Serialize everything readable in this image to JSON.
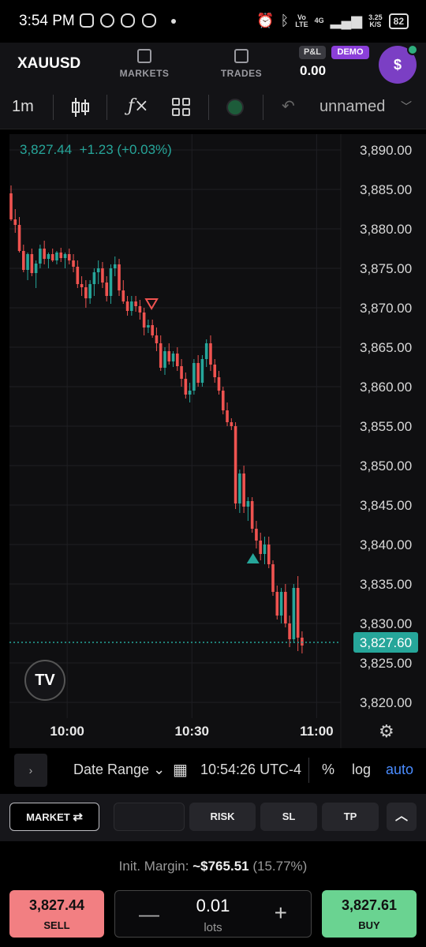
{
  "status_bar": {
    "time": "3:54 PM",
    "net_top": "Vo",
    "net_bottom": "LTE",
    "gen": "4G",
    "speed_top": "3.25",
    "speed_bottom": "K/S",
    "battery": "82"
  },
  "nav": {
    "symbol": "XAUUSD",
    "markets_label": "MARKETS",
    "trades_label": "TRADES",
    "pnl_badge": "P&L",
    "demo_badge": "DEMO",
    "pnl_value": "0.00",
    "account_icon": "$"
  },
  "toolbar": {
    "interval": "1m",
    "layout_name": "unnamed"
  },
  "chart_data": {
    "type": "candlestick",
    "legend_price": "3,827.44",
    "legend_change": "+1.23 (+0.03%)",
    "ylim": [
      3818,
      3892
    ],
    "y_ticks": [
      3890,
      3885,
      3880,
      3875,
      3870,
      3865,
      3860,
      3855,
      3850,
      3845,
      3840,
      3835,
      3830,
      3825,
      3820
    ],
    "y_tick_labels": [
      "3,890.00",
      "3,885.00",
      "3,880.00",
      "3,875.00",
      "3,870.00",
      "3,865.00",
      "3,860.00",
      "3,855.00",
      "3,850.00",
      "3,845.00",
      "3,840.00",
      "3,835.00",
      "3,830.00",
      "3,825.00",
      "3,820.00"
    ],
    "x_ticks": [
      "10:00",
      "10:30",
      "11:00"
    ],
    "x_tick_minutes": [
      13.5,
      43.5,
      73.5
    ],
    "current_price": 3827.6,
    "current_price_label": "3,827.60",
    "colors": {
      "up": "#26a69a",
      "down": "#ef5350",
      "grid": "#1f1f23",
      "bg": "#0f0f11"
    },
    "candles": [
      [
        3884.5,
        3885.5,
        3881.0,
        3881.2
      ],
      [
        3881.2,
        3882.5,
        3879.5,
        3880.5
      ],
      [
        3880.5,
        3881.5,
        3877.0,
        3877.2
      ],
      [
        3877.2,
        3878.0,
        3874.5,
        3874.8
      ],
      [
        3874.8,
        3877.0,
        3873.5,
        3876.8
      ],
      [
        3876.8,
        3877.5,
        3874.0,
        3874.4
      ],
      [
        3874.4,
        3876.0,
        3872.5,
        3875.6
      ],
      [
        3875.6,
        3878.0,
        3875.0,
        3877.5
      ],
      [
        3877.5,
        3878.5,
        3875.5,
        3876.2
      ],
      [
        3876.2,
        3877.0,
        3875.0,
        3876.8
      ],
      [
        3876.8,
        3877.5,
        3875.8,
        3876.0
      ],
      [
        3876.0,
        3877.2,
        3875.5,
        3877.0
      ],
      [
        3877.0,
        3877.6,
        3875.8,
        3876.3
      ],
      [
        3876.3,
        3877.0,
        3875.0,
        3876.8
      ],
      [
        3876.8,
        3877.5,
        3875.5,
        3876.0
      ],
      [
        3876.0,
        3876.8,
        3874.5,
        3875.2
      ],
      [
        3875.2,
        3876.0,
        3872.5,
        3873.0
      ],
      [
        3873.0,
        3874.0,
        3871.5,
        3872.6
      ],
      [
        3872.6,
        3873.5,
        3870.0,
        3871.2
      ],
      [
        3871.2,
        3873.5,
        3870.5,
        3873.0
      ],
      [
        3873.0,
        3875.0,
        3871.5,
        3874.5
      ],
      [
        3874.5,
        3876.0,
        3873.0,
        3875.0
      ],
      [
        3875.0,
        3875.8,
        3872.5,
        3873.2
      ],
      [
        3873.2,
        3874.0,
        3870.8,
        3871.5
      ],
      [
        3871.5,
        3875.5,
        3870.5,
        3875.0
      ],
      [
        3875.0,
        3876.5,
        3874.0,
        3875.5
      ],
      [
        3875.5,
        3876.2,
        3871.5,
        3872.2
      ],
      [
        3872.2,
        3873.5,
        3870.5,
        3870.8
      ],
      [
        3870.8,
        3871.5,
        3869.0,
        3869.6
      ],
      [
        3869.6,
        3871.5,
        3869.0,
        3870.8
      ],
      [
        3870.8,
        3871.5,
        3869.5,
        3870.2
      ],
      [
        3870.2,
        3871.0,
        3868.5,
        3869.4
      ],
      [
        3869.4,
        3870.0,
        3866.5,
        3867.5
      ],
      [
        3867.5,
        3868.5,
        3866.8,
        3867.8
      ],
      [
        3867.8,
        3868.5,
        3866.2,
        3866.5
      ],
      [
        3866.5,
        3867.5,
        3864.5,
        3865.5
      ],
      [
        3865.5,
        3866.5,
        3862.0,
        3862.4
      ],
      [
        3862.4,
        3865.0,
        3861.5,
        3864.5
      ],
      [
        3864.5,
        3865.5,
        3862.8,
        3863.2
      ],
      [
        3863.2,
        3864.5,
        3862.5,
        3864.2
      ],
      [
        3864.2,
        3865.0,
        3862.0,
        3862.6
      ],
      [
        3862.6,
        3863.5,
        3860.0,
        3861.0
      ],
      [
        3861.0,
        3861.8,
        3858.5,
        3859.0
      ],
      [
        3859.0,
        3860.5,
        3858.0,
        3859.5
      ],
      [
        3859.5,
        3863.5,
        3859.0,
        3863.0
      ],
      [
        3863.0,
        3864.0,
        3860.0,
        3860.5
      ],
      [
        3860.5,
        3864.0,
        3860.0,
        3863.5
      ],
      [
        3863.5,
        3866.0,
        3862.5,
        3865.5
      ],
      [
        3865.5,
        3866.5,
        3862.0,
        3862.8
      ],
      [
        3862.8,
        3863.5,
        3860.5,
        3861.2
      ],
      [
        3861.2,
        3862.0,
        3859.0,
        3859.5
      ],
      [
        3859.5,
        3860.0,
        3856.5,
        3857.0
      ],
      [
        3857.0,
        3858.0,
        3855.0,
        3855.5
      ],
      [
        3855.5,
        3856.0,
        3854.5,
        3855.0
      ],
      [
        3855.0,
        3855.5,
        3844.5,
        3845.2
      ],
      [
        3845.2,
        3849.5,
        3844.0,
        3849.0
      ],
      [
        3849.0,
        3850.0,
        3844.0,
        3844.8
      ],
      [
        3844.8,
        3846.0,
        3843.0,
        3845.5
      ],
      [
        3845.5,
        3846.0,
        3841.5,
        3842.0
      ],
      [
        3842.0,
        3843.0,
        3839.5,
        3840.5
      ],
      [
        3840.5,
        3841.5,
        3838.0,
        3838.8
      ],
      [
        3838.8,
        3841.0,
        3837.5,
        3840.0
      ],
      [
        3840.0,
        3841.0,
        3837.0,
        3837.5
      ],
      [
        3837.5,
        3838.0,
        3833.5,
        3834.0
      ],
      [
        3834.0,
        3834.8,
        3830.5,
        3831.0
      ],
      [
        3831.0,
        3834.5,
        3830.0,
        3834.0
      ],
      [
        3834.0,
        3835.0,
        3829.5,
        3830.0
      ],
      [
        3830.0,
        3831.0,
        3827.0,
        3828.0
      ],
      [
        3828.0,
        3835.0,
        3827.5,
        3834.5
      ],
      [
        3834.5,
        3836.0,
        3826.5,
        3828.2
      ],
      [
        3828.2,
        3829.0,
        3826.2,
        3827.2
      ]
    ]
  },
  "range_bar": {
    "expand_icon": "›",
    "date_range_label": "Date Range",
    "time_label": "10:54:26 UTC-4",
    "percent_label": "%",
    "log_label": "log",
    "auto_label": "auto"
  },
  "order_bar": {
    "market_label": "MARKET",
    "risk_label": "RISK",
    "sl_label": "SL",
    "tp_label": "TP"
  },
  "trade_panel": {
    "margin_label": "Init. Margin:",
    "margin_value": "~$765.51",
    "margin_pct": "(15.77%)",
    "sell_price": "3,827.44",
    "sell_label": "SELL",
    "buy_price": "3,827.61",
    "buy_label": "BUY",
    "lots_value": "0.01",
    "lots_unit": "lots",
    "minus_glyph": "—",
    "plus_glyph": "+"
  }
}
